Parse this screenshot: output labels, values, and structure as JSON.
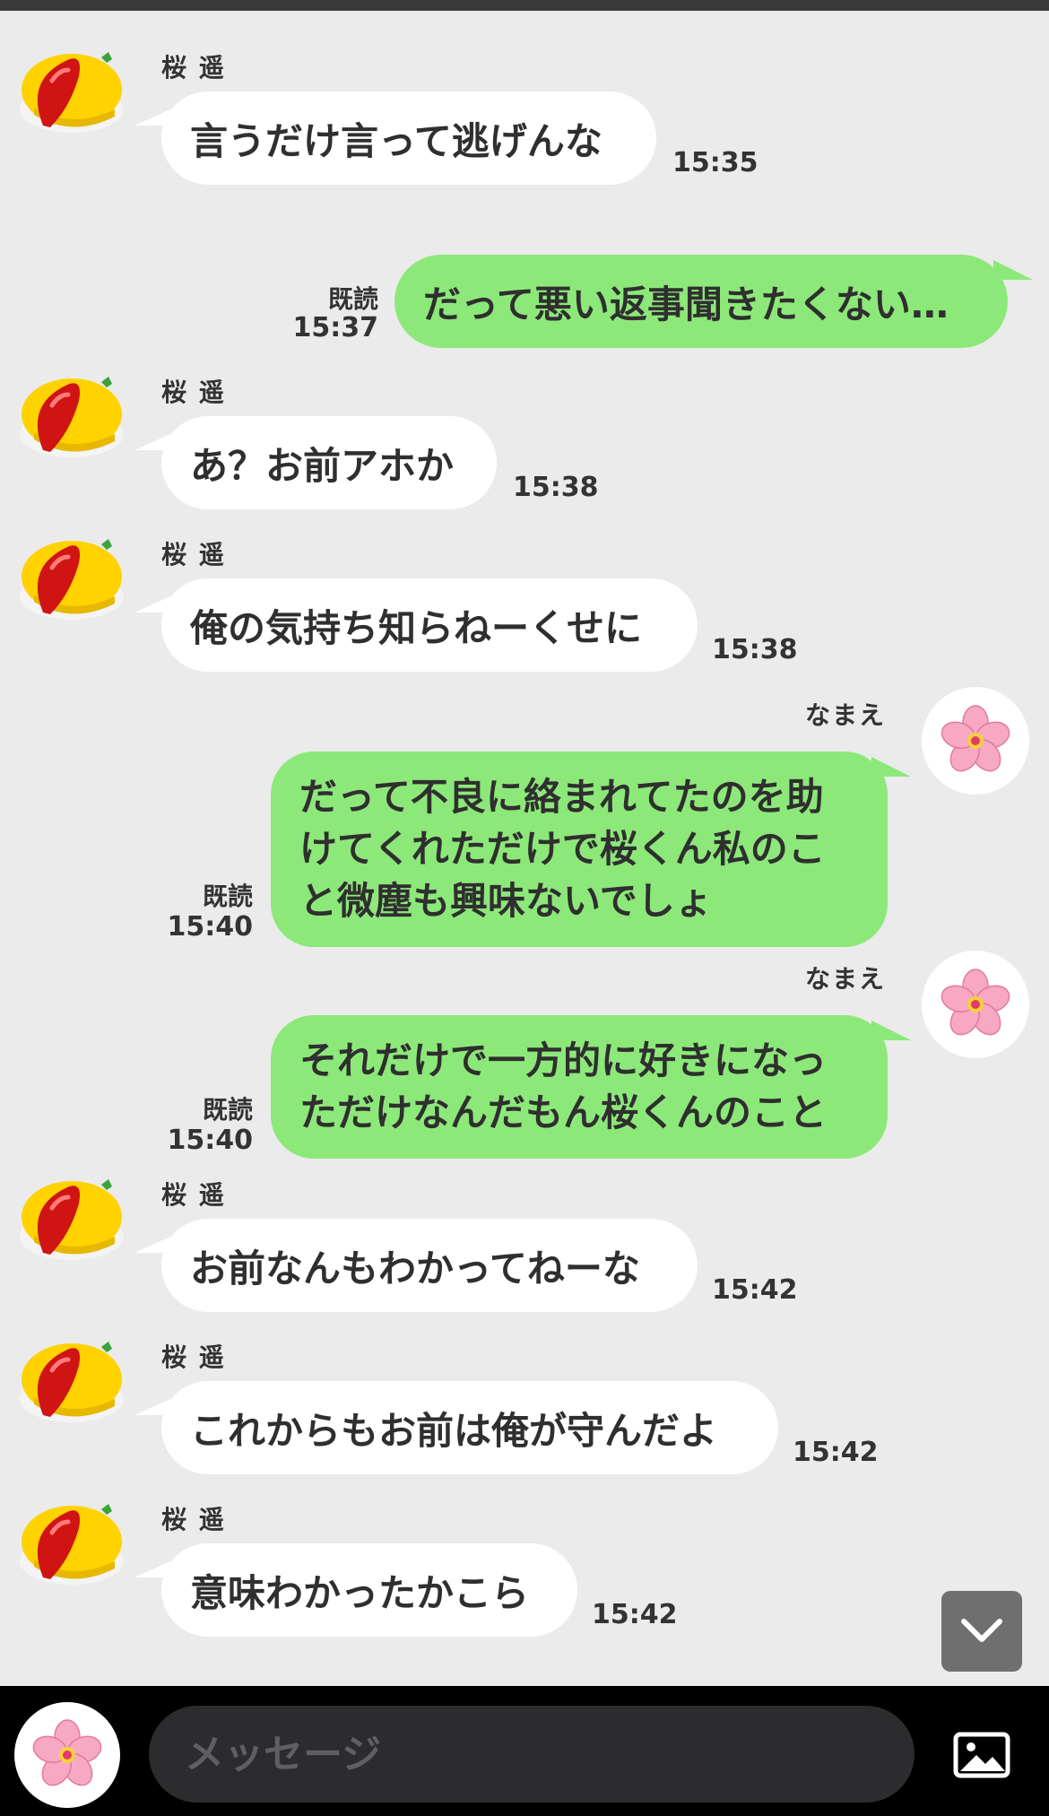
{
  "partner_name": "桜 遥",
  "my_name": "なまえ",
  "read_label": "既読",
  "composer": {
    "placeholder": "メッセージ"
  },
  "colors": {
    "incoming": "#ffffff",
    "outgoing": "#8de87a",
    "background": "#ebebeb"
  },
  "messages": [
    {
      "text": "言うだけ言って逃げんな",
      "time": "15:35"
    },
    {
      "text": "だって悪い返事聞きたくない…",
      "time": "15:37"
    },
    {
      "text": "あ？お前アホか",
      "time": "15:38"
    },
    {
      "text": "俺の気持ち知らねーくせに",
      "time": "15:38"
    },
    {
      "lines": [
        "だって不良に絡まれてたのを助",
        "けてくれただけで桜くん私のこ",
        "と微塵も興味ないでしょ"
      ],
      "time": "15:40"
    },
    {
      "lines": [
        "それだけで一方的に好きになっ",
        "ただけなんだもん桜くんのこと"
      ],
      "time": "15:40"
    },
    {
      "text": "お前なんもわかってねーな",
      "time": "15:42"
    },
    {
      "text": "これからもお前は俺が守んだよ",
      "time": "15:42"
    },
    {
      "text": "意味わかったかこら",
      "time": "15:42"
    }
  ],
  "icons": {
    "partner_avatar": "omelet-icon",
    "my_avatar": "cherry-blossom-icon",
    "scroll": "chevron-down-icon",
    "attach": "image-icon"
  }
}
